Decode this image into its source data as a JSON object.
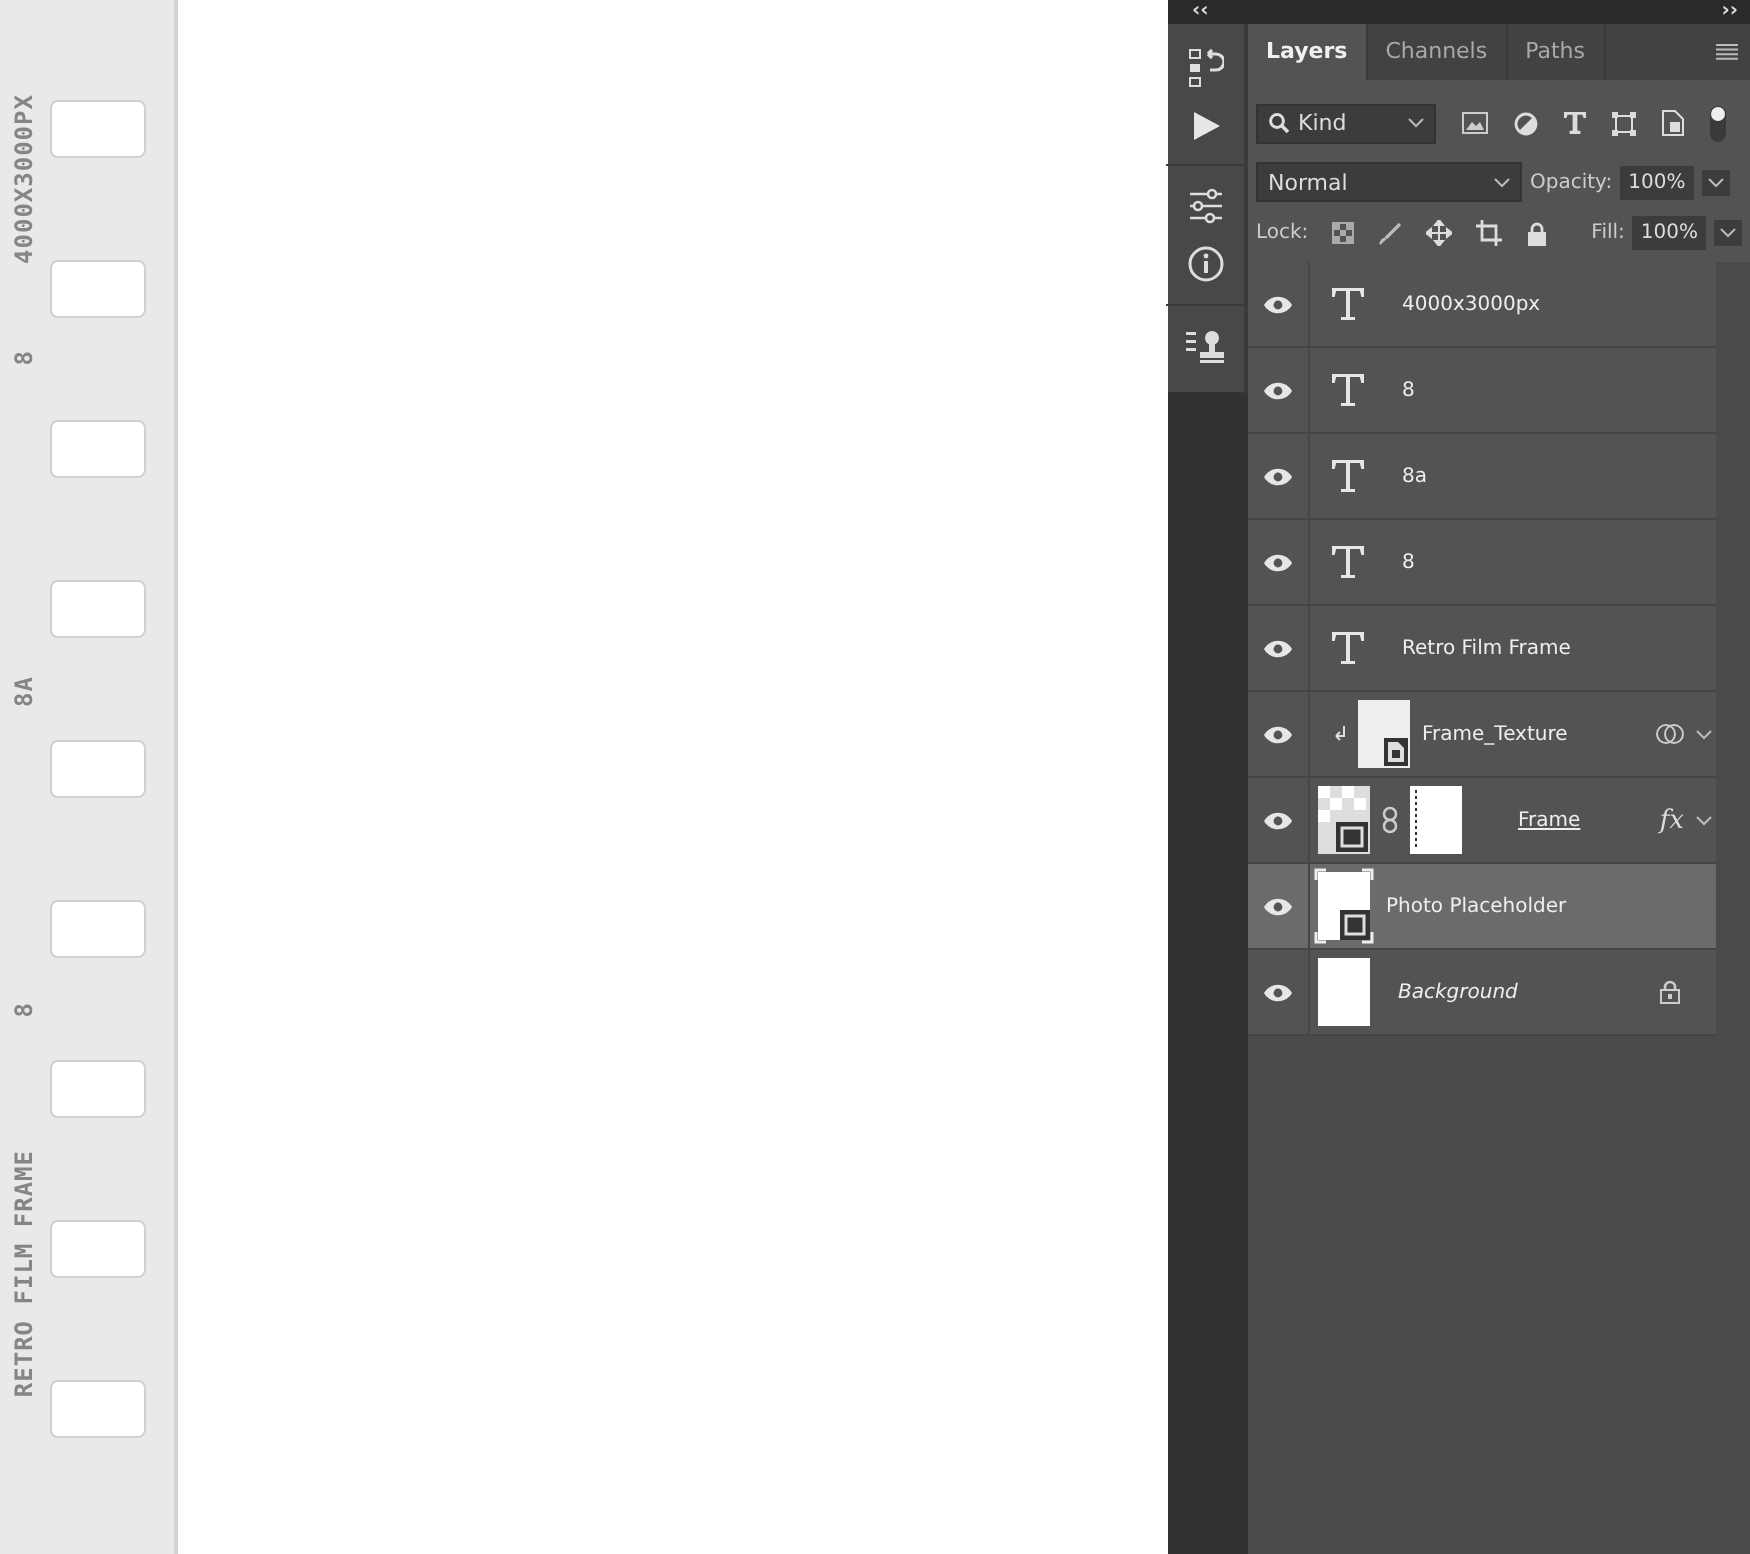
{
  "film_strip": {
    "labels": [
      {
        "text": "4000X3000PX"
      },
      {
        "text": "8"
      },
      {
        "text": "8A"
      },
      {
        "text": "8"
      },
      {
        "text": "RETRO FILM FRAME"
      }
    ]
  },
  "top_bar": {
    "collapse_left": "‹‹",
    "collapse_right": "››"
  },
  "tabs": [
    {
      "label": "Layers",
      "selected": true
    },
    {
      "label": "Channels",
      "selected": false
    },
    {
      "label": "Paths",
      "selected": false
    }
  ],
  "filter": {
    "value": "Kind"
  },
  "blend_mode": {
    "value": "Normal"
  },
  "opacity": {
    "label": "Opacity:",
    "value": "100%"
  },
  "lock": {
    "label": "Lock:"
  },
  "fill": {
    "label": "Fill:",
    "value": "100%"
  },
  "layers": [
    {
      "kind": "text",
      "name": "4000x3000px",
      "visible": true,
      "selected": false
    },
    {
      "kind": "text",
      "name": "8",
      "visible": true,
      "selected": false
    },
    {
      "kind": "text",
      "name": "8a",
      "visible": true,
      "selected": false
    },
    {
      "kind": "text",
      "name": "8",
      "visible": true,
      "selected": false
    },
    {
      "kind": "text",
      "name": "Retro Film Frame",
      "visible": true,
      "selected": false
    },
    {
      "kind": "smart",
      "name": "Frame_Texture",
      "visible": true,
      "selected": false,
      "clipped": true
    },
    {
      "kind": "masked",
      "name": "Frame",
      "visible": true,
      "selected": false,
      "effects": "fx"
    },
    {
      "kind": "placeholder",
      "name": "Photo Placeholder",
      "visible": true,
      "selected": true
    },
    {
      "kind": "background",
      "name": "Background",
      "visible": true,
      "selected": false,
      "locked": true
    }
  ]
}
